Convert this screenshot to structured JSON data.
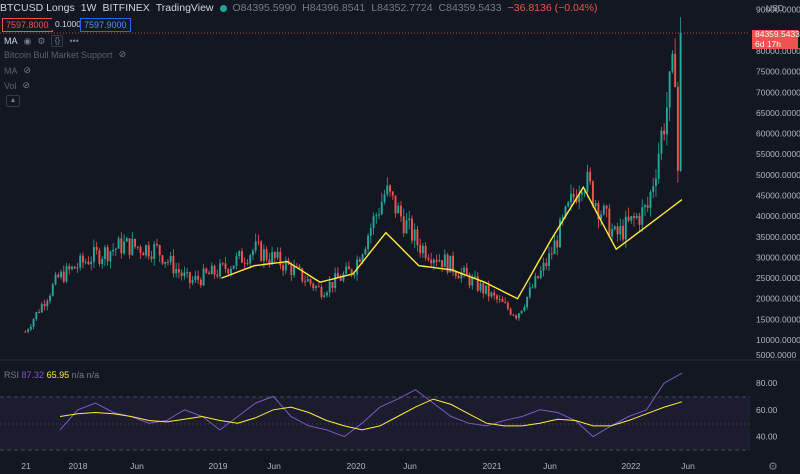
{
  "header": {
    "symbol": "BTCUSD Longs",
    "interval": "1W",
    "exchange": "BITFINEX",
    "source": "TradingView",
    "open": "O84395.5990",
    "high": "H84396.8541",
    "low": "L84352.7724",
    "close": "C84359.5433",
    "change": "−36.8136 (−0.04%)"
  },
  "order": {
    "bid": "7597.8000",
    "spread": "0.1000",
    "ask": "7597.9000"
  },
  "indicators": {
    "ma": "MA",
    "bull_support": "Bitcoin Bull Market Support",
    "ma2": "MA",
    "vol": "Vol"
  },
  "price_axis": {
    "currency": "USD",
    "labels": [
      "90000.0000",
      "80000.0000",
      "75000.0000",
      "70000.0000",
      "65000.0000",
      "60000.0000",
      "55000.0000",
      "50000.0000",
      "45000.0000",
      "40000.0000",
      "35000.0000",
      "30000.0000",
      "25000.0000",
      "20000.0000",
      "15000.0000",
      "10000.0000",
      "5000.0000"
    ],
    "last_price": "84359.5433",
    "countdown": "6d 17h"
  },
  "rsi": {
    "label": "RSI",
    "value": "87.32",
    "ma_value": "65.95",
    "na": "n/a n/a",
    "axis": [
      "80.00",
      "60.00",
      "40.00"
    ]
  },
  "time_axis": [
    "21",
    "2018",
    "Jun",
    "2019",
    "Jun",
    "2020",
    "Jun",
    "2021",
    "Jun",
    "2022",
    "Jun"
  ],
  "colors": {
    "up": "#26a69a",
    "down": "#ef5350",
    "ma": "#ffeb3b",
    "rsi": "#7e57c2",
    "background": "#131722"
  },
  "chart_data": {
    "type": "line",
    "title": "BTCUSD Longs · 1W · BITFINEX",
    "xlabel": "",
    "ylabel": "",
    "x": [
      "2017-09",
      "2017-12",
      "2018-03",
      "2018-06",
      "2018-09",
      "2018-12",
      "2019-03",
      "2019-06",
      "2019-09",
      "2019-12",
      "2020-03",
      "2020-06",
      "2020-09",
      "2020-12",
      "2021-03",
      "2021-06",
      "2021-09",
      "2021-12",
      "2022-02",
      "2022-04",
      "2022-05"
    ],
    "ylim": [
      5000,
      90000
    ],
    "series": [
      {
        "name": "BTCUSD Longs",
        "values": [
          12000,
          25000,
          30000,
          33000,
          32000,
          24000,
          27000,
          32000,
          28000,
          22000,
          27000,
          46000,
          33000,
          28000,
          22000,
          16000,
          30000,
          50000,
          35000,
          42000,
          84359.5433
        ]
      },
      {
        "name": "MA",
        "values": [
          17000,
          24000,
          30000,
          31000,
          30000,
          26000,
          25000,
          28000,
          29000,
          24000,
          26000,
          36000,
          28000,
          27000,
          24000,
          20000,
          34000,
          47000,
          32000,
          38000,
          44000
        ]
      }
    ]
  },
  "rsi_data": {
    "ylim": [
      30,
      90
    ],
    "rsi": [
      45,
      60,
      65,
      58,
      55,
      50,
      52,
      60,
      55,
      45,
      55,
      65,
      70,
      55,
      48,
      45,
      40,
      50,
      62,
      68,
      75,
      65,
      55,
      50,
      48,
      52,
      55,
      60,
      58,
      52,
      40,
      48,
      55,
      60,
      80,
      87.32
    ],
    "ma": [
      55,
      57,
      58,
      57,
      55,
      52,
      51,
      53,
      55,
      52,
      50,
      54,
      60,
      62,
      58,
      52,
      48,
      45,
      48,
      55,
      62,
      68,
      64,
      57,
      50,
      48,
      48,
      50,
      53,
      52,
      48,
      48,
      52,
      57,
      62,
      65.95
    ]
  }
}
